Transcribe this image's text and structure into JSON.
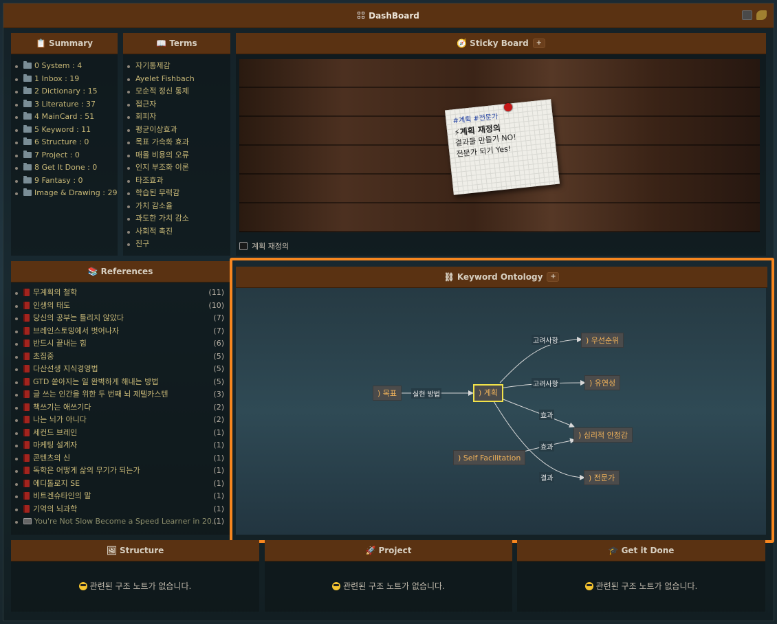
{
  "app": {
    "title": "DashBoard"
  },
  "summary": {
    "title": "Summary",
    "items": [
      "0 System : 4",
      "1 Inbox : 19",
      "2 Dictionary : 15",
      "3 Literature : 37",
      "4 MainCard : 51",
      "5 Keyword : 11",
      "6 Structure : 0",
      "7 Project : 0",
      "8 Get It Done : 0",
      "9 Fantasy : 0",
      "Image & Drawing : 29"
    ]
  },
  "terms": {
    "title": "Terms",
    "items": [
      "자기통제감",
      "Ayelet Fishbach",
      "모순적 정신 통제",
      "접근자",
      "회피자",
      "평균이상효과",
      "목표 가속화 효과",
      "매몰 비용의 오류",
      "인지 부조화 이론",
      "타조효과",
      "학습된 무력감",
      "가치 감소율",
      "과도한 가치 감소",
      "사회적 촉진",
      "친구"
    ]
  },
  "sticky": {
    "title": "Sticky Board",
    "plus": "+",
    "note_tags": "#계획 #전문가",
    "note_title": "⚡계획 재정의",
    "note_line1": "결과물 만들기 NO!",
    "note_line2": "전문가 되기 Yes!",
    "checkbox_label": "계획 재정의"
  },
  "references": {
    "title": "References",
    "items": [
      {
        "label": "무계획의 철학",
        "count": "(11)"
      },
      {
        "label": "인생의 태도",
        "count": "(10)"
      },
      {
        "label": "당신의 공부는 틀리지 않았다",
        "count": "(7)"
      },
      {
        "label": "브레인스토밍에서 벗어나자",
        "count": "(7)"
      },
      {
        "label": "반드시 끝내는 힘",
        "count": "(6)"
      },
      {
        "label": "초집중",
        "count": "(5)"
      },
      {
        "label": "다산선생 지식경영법",
        "count": "(5)"
      },
      {
        "label": "GTD 쏟아지는 일 완벽하게 해내는 방법",
        "count": "(5)"
      },
      {
        "label": "글 쓰는 인간을 위한 두 번째 뇌 제텔카스텐",
        "count": "(3)"
      },
      {
        "label": "책쓰기는 애쓰기다",
        "count": "(2)"
      },
      {
        "label": "나는 뇌가 아니다",
        "count": "(2)"
      },
      {
        "label": "세컨드 브레인",
        "count": "(1)"
      },
      {
        "label": "마케팅 설계자",
        "count": "(1)"
      },
      {
        "label": "콘텐츠의 신",
        "count": "(1)"
      },
      {
        "label": "독학은 어떻게 삶의 무기가 되는가",
        "count": "(1)"
      },
      {
        "label": "에디톨로지 SE",
        "count": "(1)"
      },
      {
        "label": "비트겐슈타인의 말",
        "count": "(1)"
      },
      {
        "label": "기억의 뇌과학",
        "count": "(1)"
      },
      {
        "label": "You're Not Slow Become a Speed Learner in 20...",
        "count": "(1)"
      }
    ]
  },
  "ontology": {
    "title": "Keyword Ontology",
    "plus": "+",
    "nodes": {
      "goal": ") 목표",
      "plan": ") 계획",
      "priority": ") 우선순위",
      "flex": ") 유연성",
      "stability": ") 심리적 안정감",
      "self": ") Self Facilitation",
      "expert": ") 전문가"
    },
    "edges": {
      "goal_plan": "실현 방법",
      "plan_priority": "고려사항",
      "plan_flex": "고려사항",
      "plan_stability": "효과",
      "self_stability": "효과",
      "plan_expert": "결과"
    }
  },
  "bottom": {
    "structure": {
      "title": "Structure",
      "message": "관련된 구조 노트가 없습니다."
    },
    "project": {
      "title": "Project",
      "message": "관련된 구조 노트가 없습니다."
    },
    "getitdone": {
      "title": "Get it Done",
      "message": "관련된 구조 노트가 없습니다."
    }
  },
  "colors": {
    "header_brown": "#5a3212",
    "highlight_orange": "#f7861f",
    "node_text": "#f0b25a",
    "selected_border": "#f2e24a"
  }
}
